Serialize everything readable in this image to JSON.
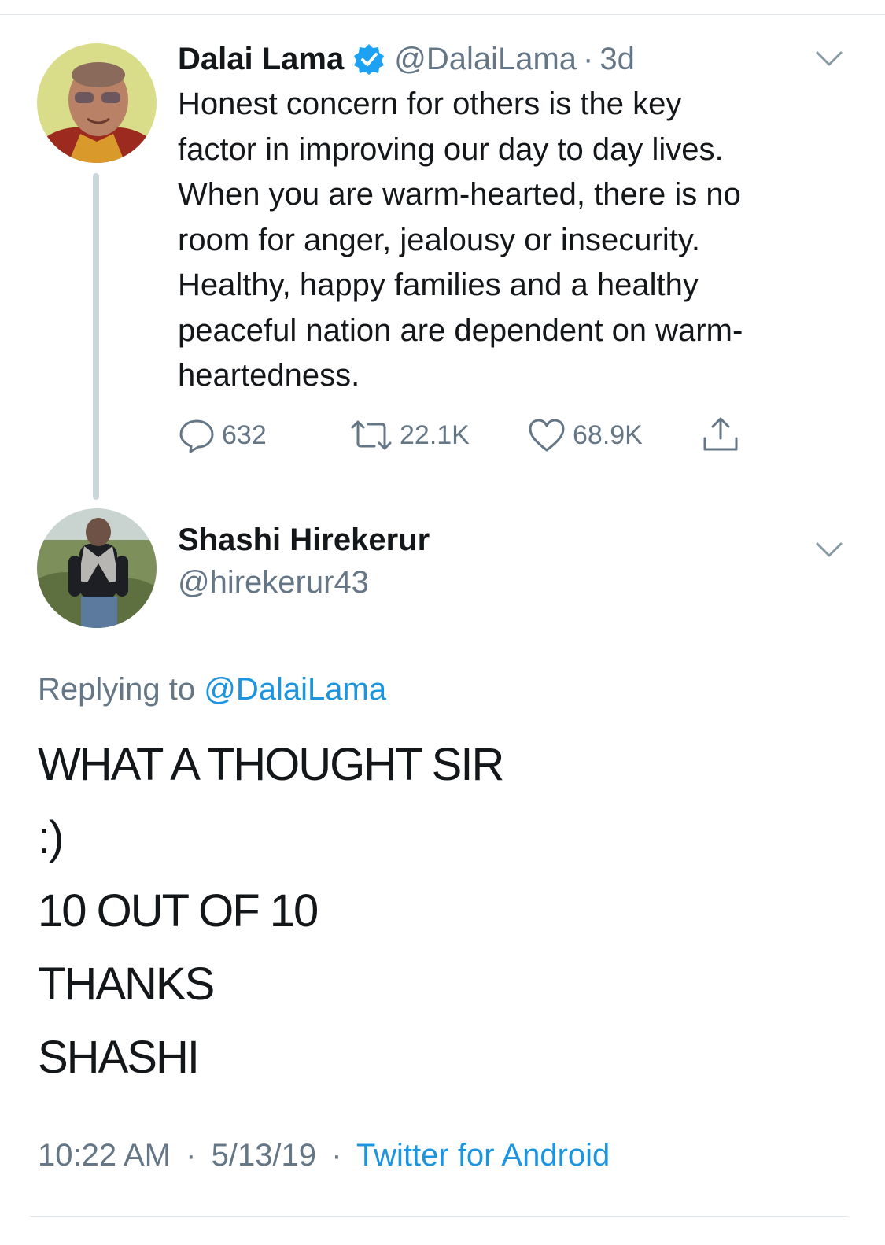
{
  "tweet": {
    "author_name": "Dalai Lama",
    "author_handle": "@DalaiLama",
    "separator": "·",
    "time_ago": "3d",
    "text_lines": [
      "Honest concern for others is the key",
      "factor in improving our day to day lives.",
      "When you are warm-hearted, there is no",
      "room for anger, jealousy or insecurity.",
      "Healthy, happy families and a healthy",
      "peaceful nation are dependent on warm-",
      "heartedness."
    ],
    "reply_count": "632",
    "retweet_count": "22.1K",
    "like_count": "68.9K",
    "verified": true
  },
  "reply": {
    "author_name": "Shashi Hirekerur",
    "author_handle": "@hirekerur43",
    "replying_prefix": "Replying to",
    "replying_mention": "@DalaiLama",
    "text_lines": [
      "WHAT A THOUGHT SIR",
      ":)",
      "10 OUT OF 10",
      "THANKS",
      "SHASHI"
    ],
    "time": "10:22 AM",
    "separator": "·",
    "date": "5/13/19",
    "source": "Twitter for Android"
  },
  "colors": {
    "text_primary": "#14171a",
    "text_secondary": "#657786",
    "link_blue": "#1b95e0",
    "verified_blue": "#1da1f2",
    "divider": "#e1e8ed",
    "thread_line": "#ccd6dd"
  },
  "icons": {
    "more": "chevron-down-icon",
    "verified": "verified-badge-icon",
    "reply": "reply-icon",
    "retweet": "retweet-icon",
    "like": "heart-icon",
    "share": "share-icon"
  }
}
